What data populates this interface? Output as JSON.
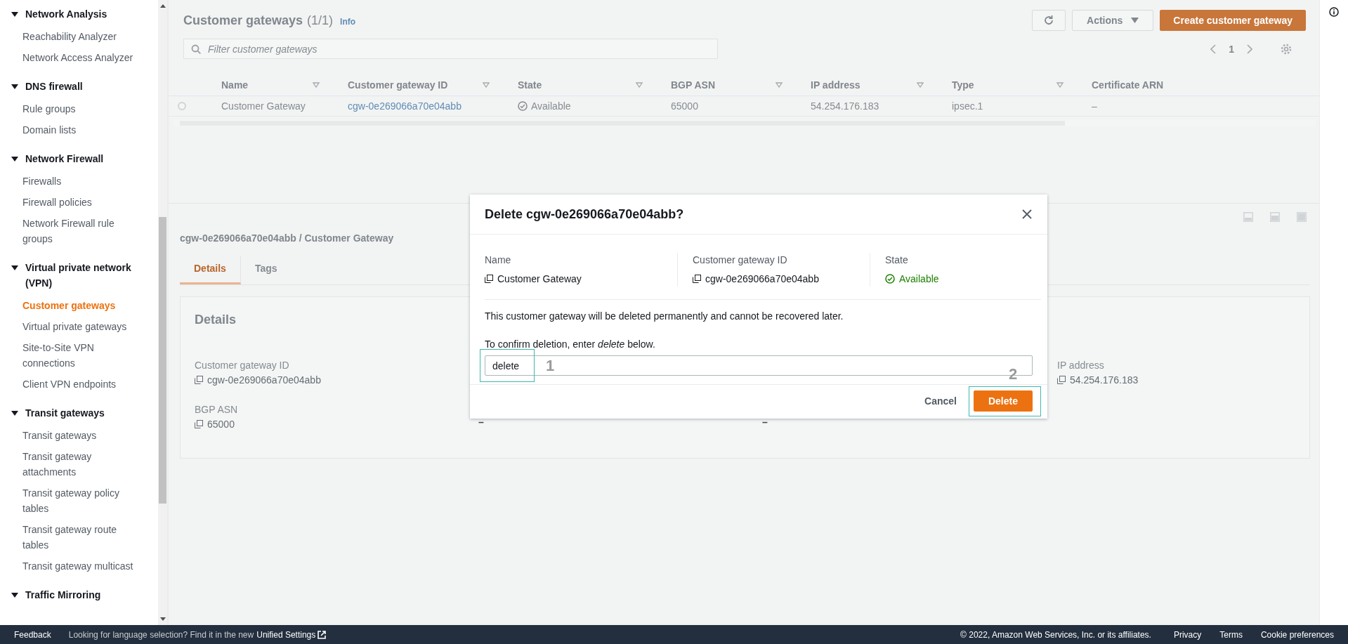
{
  "sidebar": {
    "sections": [
      {
        "title": "Network Analysis",
        "expanded": true,
        "items": [
          {
            "label": "Reachability Analyzer",
            "selected": false
          },
          {
            "label": "Network Access Analyzer",
            "selected": false
          }
        ]
      },
      {
        "title": "DNS firewall",
        "expanded": true,
        "items": [
          {
            "label": "Rule groups",
            "selected": false
          },
          {
            "label": "Domain lists",
            "selected": false
          }
        ]
      },
      {
        "title": "Network Firewall",
        "expanded": true,
        "items": [
          {
            "label": "Firewalls",
            "selected": false
          },
          {
            "label": "Firewall policies",
            "selected": false
          },
          {
            "label": "Network Firewall rule groups",
            "selected": false
          }
        ]
      },
      {
        "title": "Virtual private network (VPN)",
        "expanded": true,
        "items": [
          {
            "label": "Customer gateways",
            "selected": true
          },
          {
            "label": "Virtual private gateways",
            "selected": false
          },
          {
            "label": "Site-to-Site VPN connections",
            "selected": false
          },
          {
            "label": "Client VPN endpoints",
            "selected": false
          }
        ]
      },
      {
        "title": "Transit gateways",
        "expanded": true,
        "items": [
          {
            "label": "Transit gateways",
            "selected": false
          },
          {
            "label": "Transit gateway attachments",
            "selected": false
          },
          {
            "label": "Transit gateway policy tables",
            "selected": false
          },
          {
            "label": "Transit gateway route tables",
            "selected": false
          },
          {
            "label": "Transit gateway multicast",
            "selected": false
          }
        ]
      },
      {
        "title": "Traffic Mirroring",
        "expanded": true
      }
    ]
  },
  "list": {
    "title": "Customer gateways",
    "count": "(1/1)",
    "info": "Info",
    "actions": "Actions",
    "create": "Create customer gateway",
    "filter": {
      "placeholder": "Filter customer gateways"
    },
    "page": "1",
    "table": {
      "columns": [
        "Name",
        "Customer gateway ID",
        "State",
        "BGP ASN",
        "IP address",
        "Type",
        "Certificate ARN"
      ],
      "rows": [
        {
          "selected": false,
          "name": "Customer Gateway",
          "id": "cgw-0e269066a70e04abb",
          "state": "Available",
          "bgp_asn": "65000",
          "ip": "54.254.176.183",
          "type": "ipsec.1",
          "certificate": "–"
        }
      ]
    }
  },
  "split_panel": {
    "title": "cgw-0e269066a70e04abb / Customer Gateway",
    "tabs": [
      {
        "label": "Details",
        "selected": true
      },
      {
        "label": "Tags",
        "selected": false
      }
    ],
    "card_title": "Details",
    "columns": [
      {
        "fields": [
          {
            "label": "Customer gateway ID",
            "value": "cgw-0e269066a70e04abb"
          },
          {
            "label": "BGP ASN",
            "value": "65000"
          }
        ]
      },
      {
        "fields": [
          {
            "value": "–"
          }
        ]
      },
      {
        "fields": [
          {
            "value": "–"
          }
        ]
      },
      {
        "fields": [
          {
            "label": "IP address",
            "value": "54.254.176.183"
          }
        ]
      }
    ]
  },
  "modal": {
    "title": "Delete cgw-0e269066a70e04abb?",
    "summary": [
      {
        "kind": "copy",
        "label": "Name",
        "value": "Customer Gateway"
      },
      {
        "kind": "copy",
        "label": "Customer gateway ID",
        "value": "cgw-0e269066a70e04abb"
      },
      {
        "kind": "status",
        "label": "State",
        "value": "Available"
      }
    ],
    "warning": "This customer gateway will be deleted permanently and cannot be recovered later.",
    "confirm_label": "To confirm deletion, enter *delete* below.",
    "confirm_value": "delete",
    "cancel": "Cancel",
    "delete": "Delete",
    "annotations": [
      {
        "number": "1"
      },
      {
        "number": "2"
      }
    ]
  },
  "footer": {
    "feedback": "Feedback",
    "language_note": "Looking for language selection? Find it in the new",
    "settings_link": "Unified Settings",
    "copyright": "© 2022, Amazon Web Services, Inc. or its affiliates.",
    "links": [
      "Privacy",
      "Terms",
      "Cookie preferences"
    ]
  }
}
